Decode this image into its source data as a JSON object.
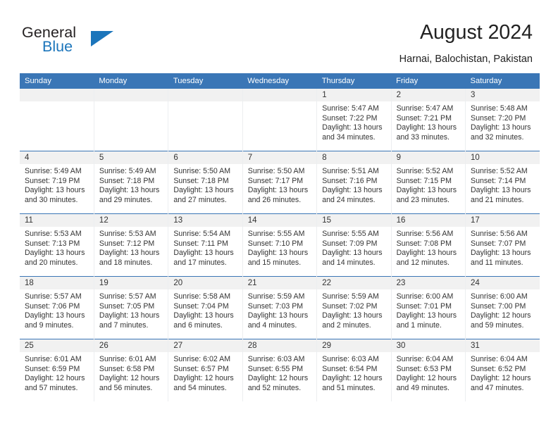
{
  "brand": {
    "name_part1": "General",
    "name_part2": "Blue",
    "logo_icon": "triangle-icon",
    "accent_color": "#1b75bb"
  },
  "header": {
    "title": "August 2024",
    "subtitle": "Harnai, Balochistan, Pakistan"
  },
  "theme": {
    "header_blue": "#3a76b6",
    "daynum_band": "#f1f1f1",
    "text": "#333333",
    "cell_divider": "#eceef0"
  },
  "calendar": {
    "weekday_headers": [
      "Sunday",
      "Monday",
      "Tuesday",
      "Wednesday",
      "Thursday",
      "Friday",
      "Saturday"
    ],
    "weeks": [
      [
        {
          "day": "",
          "empty": true
        },
        {
          "day": "",
          "empty": true
        },
        {
          "day": "",
          "empty": true
        },
        {
          "day": "",
          "empty": true
        },
        {
          "day": "1",
          "sunrise": "Sunrise: 5:47 AM",
          "sunset": "Sunset: 7:22 PM",
          "daylight_line1": "Daylight: 13 hours",
          "daylight_line2": "and 34 minutes."
        },
        {
          "day": "2",
          "sunrise": "Sunrise: 5:47 AM",
          "sunset": "Sunset: 7:21 PM",
          "daylight_line1": "Daylight: 13 hours",
          "daylight_line2": "and 33 minutes."
        },
        {
          "day": "3",
          "sunrise": "Sunrise: 5:48 AM",
          "sunset": "Sunset: 7:20 PM",
          "daylight_line1": "Daylight: 13 hours",
          "daylight_line2": "and 32 minutes."
        }
      ],
      [
        {
          "day": "4",
          "sunrise": "Sunrise: 5:49 AM",
          "sunset": "Sunset: 7:19 PM",
          "daylight_line1": "Daylight: 13 hours",
          "daylight_line2": "and 30 minutes."
        },
        {
          "day": "5",
          "sunrise": "Sunrise: 5:49 AM",
          "sunset": "Sunset: 7:18 PM",
          "daylight_line1": "Daylight: 13 hours",
          "daylight_line2": "and 29 minutes."
        },
        {
          "day": "6",
          "sunrise": "Sunrise: 5:50 AM",
          "sunset": "Sunset: 7:18 PM",
          "daylight_line1": "Daylight: 13 hours",
          "daylight_line2": "and 27 minutes."
        },
        {
          "day": "7",
          "sunrise": "Sunrise: 5:50 AM",
          "sunset": "Sunset: 7:17 PM",
          "daylight_line1": "Daylight: 13 hours",
          "daylight_line2": "and 26 minutes."
        },
        {
          "day": "8",
          "sunrise": "Sunrise: 5:51 AM",
          "sunset": "Sunset: 7:16 PM",
          "daylight_line1": "Daylight: 13 hours",
          "daylight_line2": "and 24 minutes."
        },
        {
          "day": "9",
          "sunrise": "Sunrise: 5:52 AM",
          "sunset": "Sunset: 7:15 PM",
          "daylight_line1": "Daylight: 13 hours",
          "daylight_line2": "and 23 minutes."
        },
        {
          "day": "10",
          "sunrise": "Sunrise: 5:52 AM",
          "sunset": "Sunset: 7:14 PM",
          "daylight_line1": "Daylight: 13 hours",
          "daylight_line2": "and 21 minutes."
        }
      ],
      [
        {
          "day": "11",
          "sunrise": "Sunrise: 5:53 AM",
          "sunset": "Sunset: 7:13 PM",
          "daylight_line1": "Daylight: 13 hours",
          "daylight_line2": "and 20 minutes."
        },
        {
          "day": "12",
          "sunrise": "Sunrise: 5:53 AM",
          "sunset": "Sunset: 7:12 PM",
          "daylight_line1": "Daylight: 13 hours",
          "daylight_line2": "and 18 minutes."
        },
        {
          "day": "13",
          "sunrise": "Sunrise: 5:54 AM",
          "sunset": "Sunset: 7:11 PM",
          "daylight_line1": "Daylight: 13 hours",
          "daylight_line2": "and 17 minutes."
        },
        {
          "day": "14",
          "sunrise": "Sunrise: 5:55 AM",
          "sunset": "Sunset: 7:10 PM",
          "daylight_line1": "Daylight: 13 hours",
          "daylight_line2": "and 15 minutes."
        },
        {
          "day": "15",
          "sunrise": "Sunrise: 5:55 AM",
          "sunset": "Sunset: 7:09 PM",
          "daylight_line1": "Daylight: 13 hours",
          "daylight_line2": "and 14 minutes."
        },
        {
          "day": "16",
          "sunrise": "Sunrise: 5:56 AM",
          "sunset": "Sunset: 7:08 PM",
          "daylight_line1": "Daylight: 13 hours",
          "daylight_line2": "and 12 minutes."
        },
        {
          "day": "17",
          "sunrise": "Sunrise: 5:56 AM",
          "sunset": "Sunset: 7:07 PM",
          "daylight_line1": "Daylight: 13 hours",
          "daylight_line2": "and 11 minutes."
        }
      ],
      [
        {
          "day": "18",
          "sunrise": "Sunrise: 5:57 AM",
          "sunset": "Sunset: 7:06 PM",
          "daylight_line1": "Daylight: 13 hours",
          "daylight_line2": "and 9 minutes."
        },
        {
          "day": "19",
          "sunrise": "Sunrise: 5:57 AM",
          "sunset": "Sunset: 7:05 PM",
          "daylight_line1": "Daylight: 13 hours",
          "daylight_line2": "and 7 minutes."
        },
        {
          "day": "20",
          "sunrise": "Sunrise: 5:58 AM",
          "sunset": "Sunset: 7:04 PM",
          "daylight_line1": "Daylight: 13 hours",
          "daylight_line2": "and 6 minutes."
        },
        {
          "day": "21",
          "sunrise": "Sunrise: 5:59 AM",
          "sunset": "Sunset: 7:03 PM",
          "daylight_line1": "Daylight: 13 hours",
          "daylight_line2": "and 4 minutes."
        },
        {
          "day": "22",
          "sunrise": "Sunrise: 5:59 AM",
          "sunset": "Sunset: 7:02 PM",
          "daylight_line1": "Daylight: 13 hours",
          "daylight_line2": "and 2 minutes."
        },
        {
          "day": "23",
          "sunrise": "Sunrise: 6:00 AM",
          "sunset": "Sunset: 7:01 PM",
          "daylight_line1": "Daylight: 13 hours",
          "daylight_line2": "and 1 minute."
        },
        {
          "day": "24",
          "sunrise": "Sunrise: 6:00 AM",
          "sunset": "Sunset: 7:00 PM",
          "daylight_line1": "Daylight: 12 hours",
          "daylight_line2": "and 59 minutes."
        }
      ],
      [
        {
          "day": "25",
          "sunrise": "Sunrise: 6:01 AM",
          "sunset": "Sunset: 6:59 PM",
          "daylight_line1": "Daylight: 12 hours",
          "daylight_line2": "and 57 minutes."
        },
        {
          "day": "26",
          "sunrise": "Sunrise: 6:01 AM",
          "sunset": "Sunset: 6:58 PM",
          "daylight_line1": "Daylight: 12 hours",
          "daylight_line2": "and 56 minutes."
        },
        {
          "day": "27",
          "sunrise": "Sunrise: 6:02 AM",
          "sunset": "Sunset: 6:57 PM",
          "daylight_line1": "Daylight: 12 hours",
          "daylight_line2": "and 54 minutes."
        },
        {
          "day": "28",
          "sunrise": "Sunrise: 6:03 AM",
          "sunset": "Sunset: 6:55 PM",
          "daylight_line1": "Daylight: 12 hours",
          "daylight_line2": "and 52 minutes."
        },
        {
          "day": "29",
          "sunrise": "Sunrise: 6:03 AM",
          "sunset": "Sunset: 6:54 PM",
          "daylight_line1": "Daylight: 12 hours",
          "daylight_line2": "and 51 minutes."
        },
        {
          "day": "30",
          "sunrise": "Sunrise: 6:04 AM",
          "sunset": "Sunset: 6:53 PM",
          "daylight_line1": "Daylight: 12 hours",
          "daylight_line2": "and 49 minutes."
        },
        {
          "day": "31",
          "sunrise": "Sunrise: 6:04 AM",
          "sunset": "Sunset: 6:52 PM",
          "daylight_line1": "Daylight: 12 hours",
          "daylight_line2": "and 47 minutes."
        }
      ]
    ]
  }
}
